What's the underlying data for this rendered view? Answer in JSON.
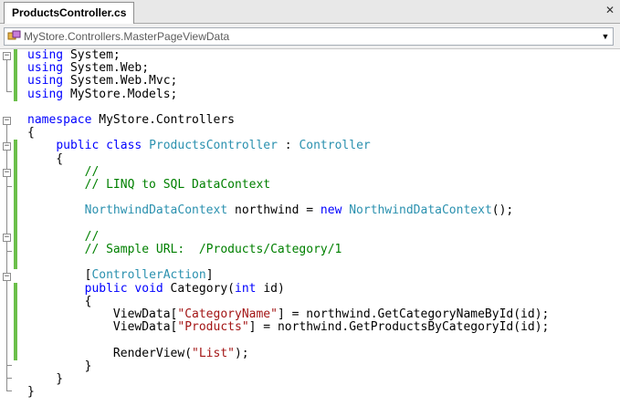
{
  "tab": {
    "title": "ProductsController.cs",
    "close": "✕"
  },
  "nav": {
    "combo_text": "MyStore.Controllers.MasterPageViewData",
    "arrow": "▼"
  },
  "code": {
    "l1": {
      "k": "using",
      "t": " System;"
    },
    "l2": {
      "k": "using",
      "t": " System.Web;"
    },
    "l3": {
      "k": "using",
      "t": " System.Web.Mvc;"
    },
    "l4": {
      "k": "using",
      "t": " MyStore.Models;"
    },
    "l6": {
      "k": "namespace",
      "t": " MyStore.Controllers"
    },
    "l7": "{",
    "l8": {
      "indent": "    ",
      "k1": "public",
      "k2": "class",
      "ty1": "ProductsController",
      "sep": " : ",
      "ty2": "Controller"
    },
    "l9": "    {",
    "l10": "        //",
    "l11": "        // LINQ to SQL DataContext",
    "l13": {
      "indent": "        ",
      "ty1": "NorthwindDataContext",
      "mid": " northwind = ",
      "k": "new",
      "ty2": "NorthwindDataContext",
      "end": "();"
    },
    "l15": "        //",
    "l16": "        // Sample URL:  /Products/Category/1",
    "l18": {
      "indent": "        ",
      "open": "[",
      "ty": "ControllerAction",
      "close": "]"
    },
    "l19": {
      "indent": "        ",
      "k1": "public",
      "k2": "void",
      "m1": " Category(",
      "k3": "int",
      "m2": " id)"
    },
    "l20": "        {",
    "l21": {
      "indent": "            ",
      "pre": "ViewData[",
      "s": "\"CategoryName\"",
      "post": "] = northwind.GetCategoryNameById(id);"
    },
    "l22": {
      "indent": "            ",
      "pre": "ViewData[",
      "s": "\"Products\"",
      "post": "] = northwind.GetProductsByCategoryId(id);"
    },
    "l24": {
      "indent": "            ",
      "pre": "RenderView(",
      "s": "\"List\"",
      "post": ");"
    },
    "l25": "        }",
    "l26": "    }",
    "l27": "}"
  },
  "colors": {
    "keyword": "#0000ff",
    "type": "#2b91af",
    "comment": "#008000",
    "string": "#a31515",
    "change_bar": "#6bbf4a"
  }
}
